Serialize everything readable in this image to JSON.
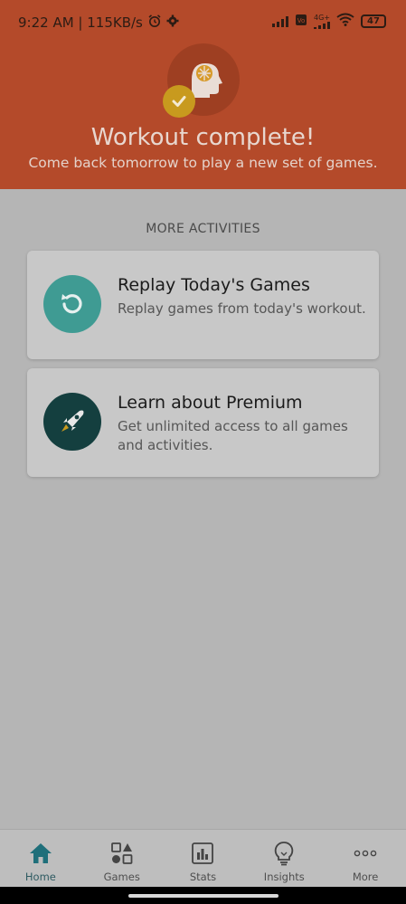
{
  "status_bar": {
    "time_speed": "9:22 AM | 115KB/s",
    "network_label": "4G+",
    "battery": "47"
  },
  "header": {
    "title": "Workout complete!",
    "subtitle": "Come back tomorrow to play a new set of games."
  },
  "more_activities": {
    "label": "MORE ACTIVITIES",
    "cards": [
      {
        "title": "Replay Today's Games",
        "description": "Replay games from today's workout."
      },
      {
        "title": "Learn about Premium",
        "description": "Get unlimited access to all games and activities."
      }
    ]
  },
  "bottom_nav": {
    "items": [
      {
        "label": "Home",
        "icon": "home-icon",
        "active": true
      },
      {
        "label": "Games",
        "icon": "games-icon",
        "active": false
      },
      {
        "label": "Stats",
        "icon": "stats-icon",
        "active": false
      },
      {
        "label": "Insights",
        "icon": "lightbulb-icon",
        "active": false
      },
      {
        "label": "More",
        "icon": "more-dots-icon",
        "active": false
      }
    ]
  },
  "colors": {
    "header_bg": "#b44a2a",
    "replay_icon_bg": "#3f9b93",
    "premium_icon_bg": "#143f3f",
    "home_active": "#1f6f7a"
  }
}
